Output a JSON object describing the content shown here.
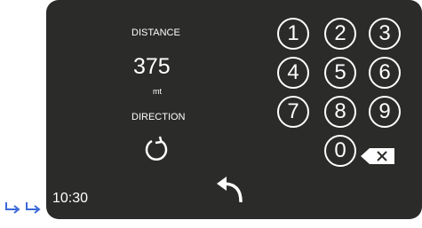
{
  "screen": {
    "distance_label": "DISTANCE",
    "distance_value": "375",
    "distance_unit": "mt",
    "direction_label": "DIRECTION",
    "time": "10:30"
  },
  "keypad": {
    "keys": [
      "1",
      "2",
      "3",
      "4",
      "5",
      "6",
      "7",
      "8",
      "9",
      "0"
    ]
  },
  "icons": {
    "rotate": "refresh-icon",
    "back": "back-arrow-icon",
    "backspace": "backspace-icon",
    "corner": "return-arrows-icon"
  },
  "colors": {
    "screen": "#2b2b2a",
    "foreground": "#ffffff",
    "corner_arrows": "#3a68d8"
  }
}
